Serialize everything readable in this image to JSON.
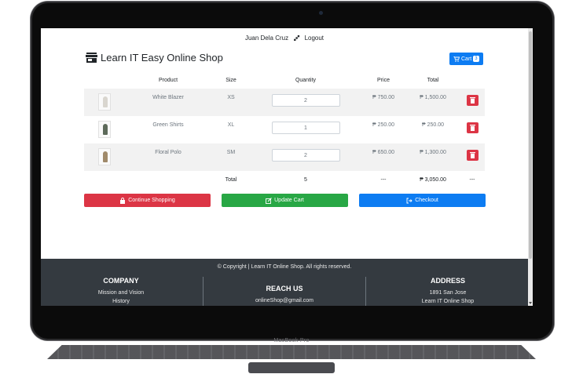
{
  "device": {
    "label": "MacBook Pro"
  },
  "nav": {
    "user_name": "Juan Dela Cruz",
    "logout_label": "Logout"
  },
  "brand": {
    "name": "Learn IT Easy Online Shop",
    "icon": "store-icon"
  },
  "cart": {
    "label": "Cart",
    "count": "3",
    "icon": "shopping-cart-icon"
  },
  "table": {
    "headers": [
      "Product",
      "Size",
      "Quantity",
      "Price",
      "Total"
    ],
    "rows": [
      {
        "product": "White Blazer",
        "size": "XS",
        "quantity": "2",
        "price": "₱ 750.00",
        "total": "₱ 1,500.00"
      },
      {
        "product": "Green Shirts",
        "size": "XL",
        "quantity": "1",
        "price": "₱ 250.00",
        "total": "₱ 250.00"
      },
      {
        "product": "Floral Polo",
        "size": "SM",
        "quantity": "2",
        "price": "₱ 650.00",
        "total": "₱ 1,300.00"
      }
    ],
    "summary": {
      "label": "Total",
      "quantity": "5",
      "price": "---",
      "total": "₱ 3,050.00",
      "action": "---"
    }
  },
  "actions": {
    "continue_label": "Continue Shopping",
    "update_label": "Update Cart",
    "checkout_label": "Checkout"
  },
  "footer": {
    "copyright": "© Copyright | Learn IT Online Shop. All rights reserved.",
    "company": {
      "title": "COMPANY",
      "line1": "Mission and Vision",
      "line2": "History"
    },
    "reach": {
      "title": "REACH US",
      "line1": "onlineShop@gmail.com"
    },
    "address": {
      "title": "ADDRESS",
      "line1": "1891 San Jose",
      "line2": "Learn IT Online Shop"
    }
  },
  "colors": {
    "primary": "#0d7cf2",
    "danger": "#dc3545",
    "success": "#28a745",
    "footer_bg": "#343a40"
  }
}
